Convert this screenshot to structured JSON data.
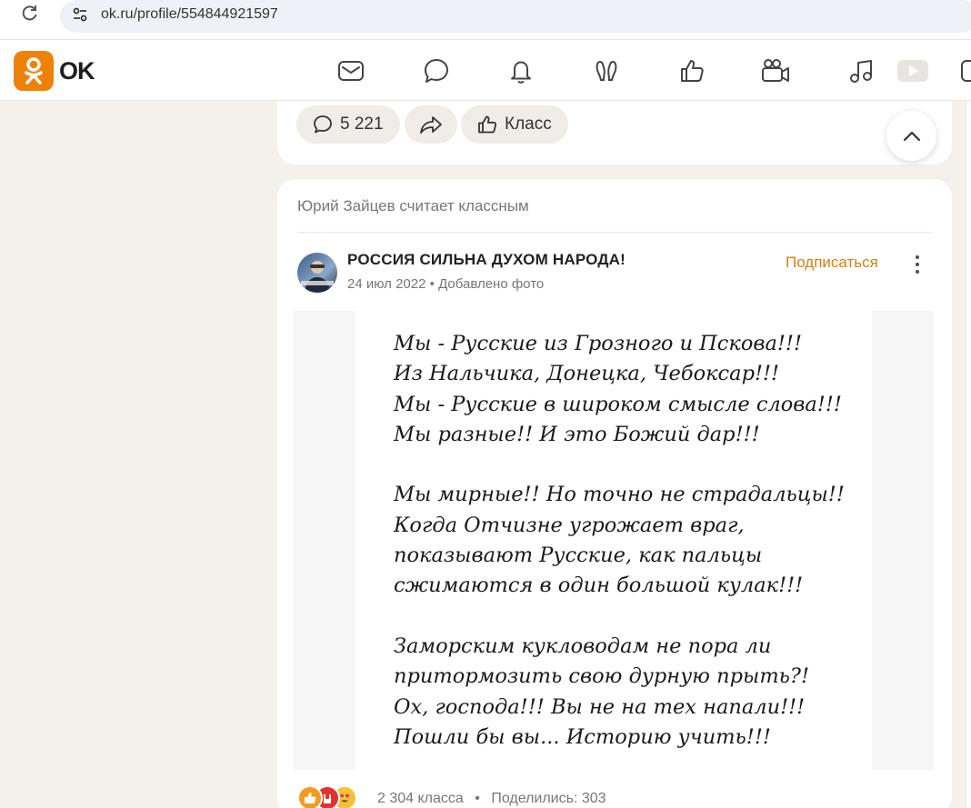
{
  "browser": {
    "url": "ok.ru/profile/554844921597"
  },
  "header": {
    "logo_text": "OK",
    "brand_color": "#ee8208",
    "nav_icons": [
      "mail-icon",
      "chat-icon",
      "bell-icon",
      "guests-icon",
      "like-icon",
      "video-camera-icon",
      "music-icon",
      "video-icon"
    ]
  },
  "top_post_actions": {
    "comments_count": "5 221",
    "class_label": "Класс"
  },
  "feed_item": {
    "liked_by": "Юрий Зайцев считает классным",
    "group_name": "РОССИЯ СИЛЬНА ДУХОМ НАРОДА!",
    "date": "24 июл 2022",
    "meta_separator": "•",
    "action": "Добавлено фото",
    "subscribe_label": "Подписаться",
    "image_text": "Мы - Русские из Грозного и Пскова!!!\nИз Нальчика, Донецка, Чебоксар!!!\nМы - Русские в широком смысле слова!!!\nМы разные!! И это Божий дар!!!\n\nМы мирные!! Но точно не страдальцы!!\nКогда Отчизне угрожает враг,\nпоказывают Русские, как пальцы\nсжимаются в один большой кулак!!!\n\nЗаморским кукловодам не пора ли\nпритормозить свою дурную прыть?!\nОх, господа!!! Вы не на тех напали!!!\nПошли бы вы... Историю учить!!!",
    "class_count": "2 304 класса",
    "stats_separator": "•",
    "shares": "Поделились: 303"
  }
}
